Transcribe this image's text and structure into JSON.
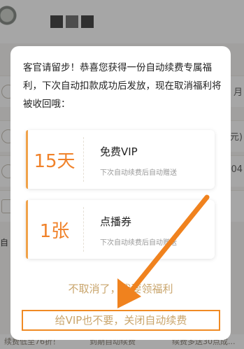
{
  "background": {
    "rows_right": [
      "月",
      "元)",
      "-04"
    ],
    "strip_left": "自",
    "bottom": [
      "续费低至76折！",
      "到期自动续费",
      "续费多送30点成..."
    ]
  },
  "dialog": {
    "message": "客官请留步！恭喜您获得一份自动续费专属福利，下次自动扣款成功后发放，现在取消福利将被收回哦：",
    "cards": [
      {
        "amount": "15天",
        "title": "免费VIP",
        "subtitle": "下次自动续费后自动赠送"
      },
      {
        "amount": "1张",
        "title": "点播券",
        "subtitle": "下次自动续费后自动赠送"
      }
    ],
    "keep_button": "不取消了，我要领福利",
    "close_button": "给VIP也不要，关闭自动续费"
  },
  "colors": {
    "accent": "#f08a24",
    "gold_text": "#c9a56c",
    "overlay": "rgba(0,0,0,0.35)"
  },
  "icons": [
    "user-avatar",
    "arrow-annotation"
  ]
}
